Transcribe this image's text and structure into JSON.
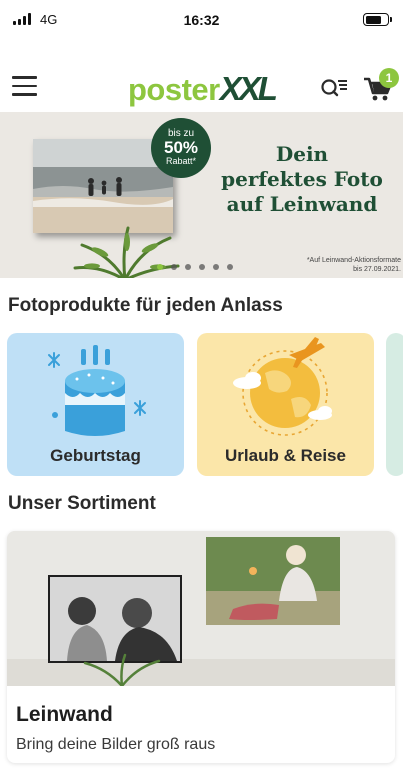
{
  "status_bar": {
    "network": "4G",
    "time": "16:32"
  },
  "header": {
    "logo_part1": "poster",
    "logo_part2": "XXL",
    "cart_count": "1"
  },
  "banner": {
    "badge_line1": "bis zu",
    "badge_line2": "50%",
    "badge_line3": "Rabatt*",
    "headline_line1": "Dein",
    "headline_line2": "perfektes Foto",
    "headline_line3": "auf Leinwand",
    "footnote_line1": "*Auf Leinwand-Aktionsformate",
    "footnote_line2": "bis 27.09.2021.",
    "slide_count": 6,
    "active_slide": 1
  },
  "occasions": {
    "title": "Fotoprodukte für jeden Anlass",
    "items": [
      {
        "label": "Geburtstag",
        "color": "#bfe0f6"
      },
      {
        "label": "Urlaub & Reise",
        "color": "#fbe6a9"
      }
    ]
  },
  "assortment": {
    "title": "Unser Sortiment",
    "product_title": "Leinwand",
    "product_subtitle": "Bring deine Bilder groß raus"
  },
  "colors": {
    "brand_green": "#8dc63f",
    "brand_dark_green": "#1f4f35"
  }
}
